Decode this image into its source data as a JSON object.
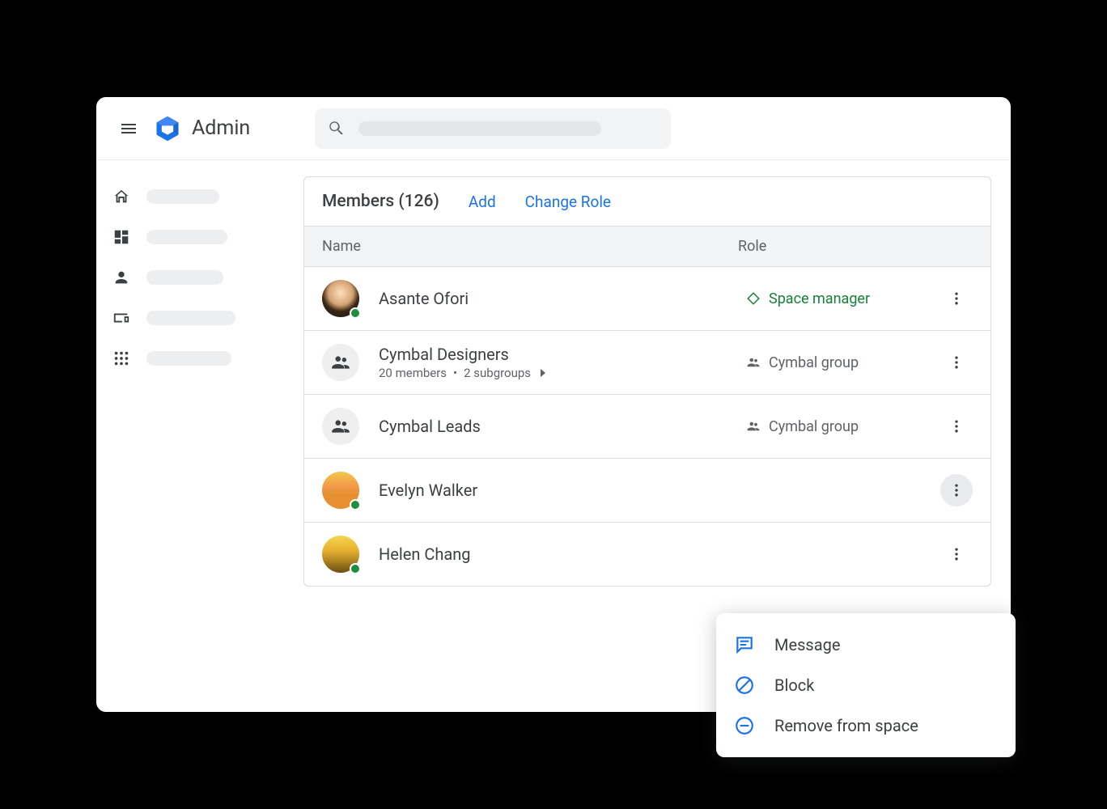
{
  "app": {
    "title": "Admin"
  },
  "panel": {
    "title": "Members (126)",
    "add_label": "Add",
    "change_role_label": "Change Role",
    "col_name": "Name",
    "col_role": "Role"
  },
  "members": [
    {
      "name": "Asante Ofori",
      "role": "Space manager",
      "role_type": "manager",
      "avatar_type": "person",
      "presence": true
    },
    {
      "name": "Cymbal Designers",
      "role": "Cymbal group",
      "role_type": "group",
      "avatar_type": "group",
      "meta_members": "20 members",
      "meta_subgroups": "2 subgroups"
    },
    {
      "name": "Cymbal Leads",
      "role": "Cymbal group",
      "role_type": "group",
      "avatar_type": "group"
    },
    {
      "name": "Evelyn Walker",
      "role": "",
      "role_type": "",
      "avatar_type": "person",
      "presence": true,
      "menu_open": true
    },
    {
      "name": "Helen Chang",
      "role": "",
      "role_type": "",
      "avatar_type": "person",
      "presence": true
    }
  ],
  "popup": {
    "message": "Message",
    "block": "Block",
    "remove": "Remove from space"
  }
}
